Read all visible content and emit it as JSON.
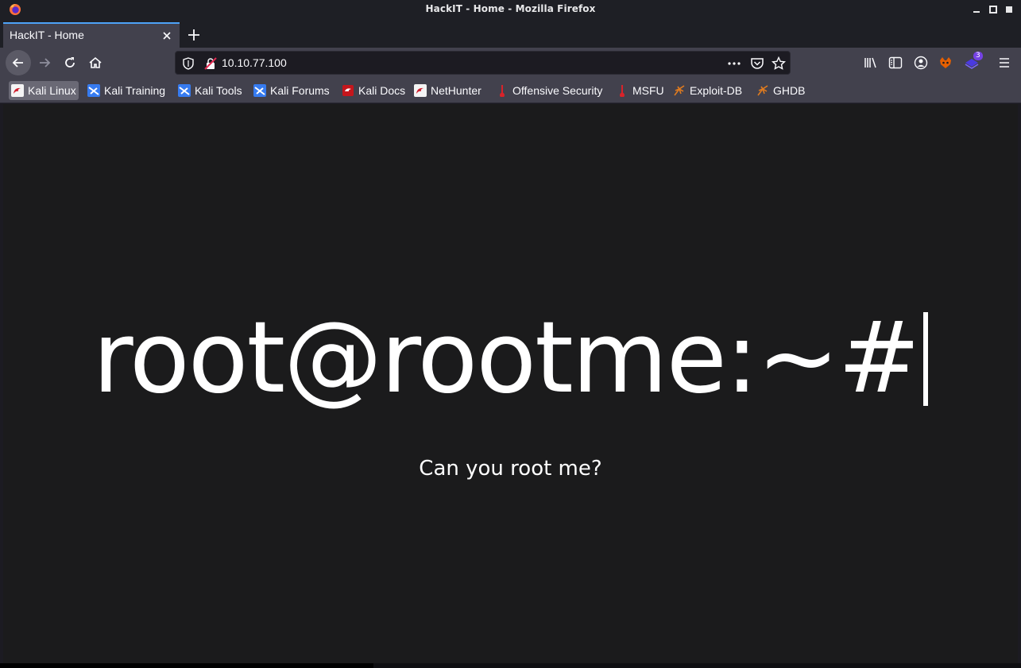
{
  "window": {
    "title": "HackIT - Home - Mozilla Firefox"
  },
  "tabs": [
    {
      "label": "HackIT - Home"
    }
  ],
  "urlbar": {
    "url": "10.10.77.100"
  },
  "toolbar": {
    "extension_badge": "3"
  },
  "bookmarks": [
    {
      "label": "Kali Linux",
      "icon": "kali-dragon-icon"
    },
    {
      "label": "Kali Training",
      "icon": "kali-training-icon"
    },
    {
      "label": "Kali Tools",
      "icon": "kali-tools-icon"
    },
    {
      "label": "Kali Forums",
      "icon": "kali-forums-icon"
    },
    {
      "label": "Kali Docs",
      "icon": "kali-docs-icon"
    },
    {
      "label": "NetHunter",
      "icon": "nethunter-icon"
    },
    {
      "label": "Offensive Security",
      "icon": "offsec-icon"
    },
    {
      "label": "MSFU",
      "icon": "msfu-icon"
    },
    {
      "label": "Exploit-DB",
      "icon": "exploitdb-icon"
    },
    {
      "label": "GHDB",
      "icon": "ghdb-icon"
    }
  ],
  "page": {
    "headline": "root@rootme:~#",
    "subtitle": "Can you root me?"
  },
  "colors": {
    "accent": "#4da2f7",
    "page_background": "#1b1b1c",
    "chrome": "#42414d"
  }
}
